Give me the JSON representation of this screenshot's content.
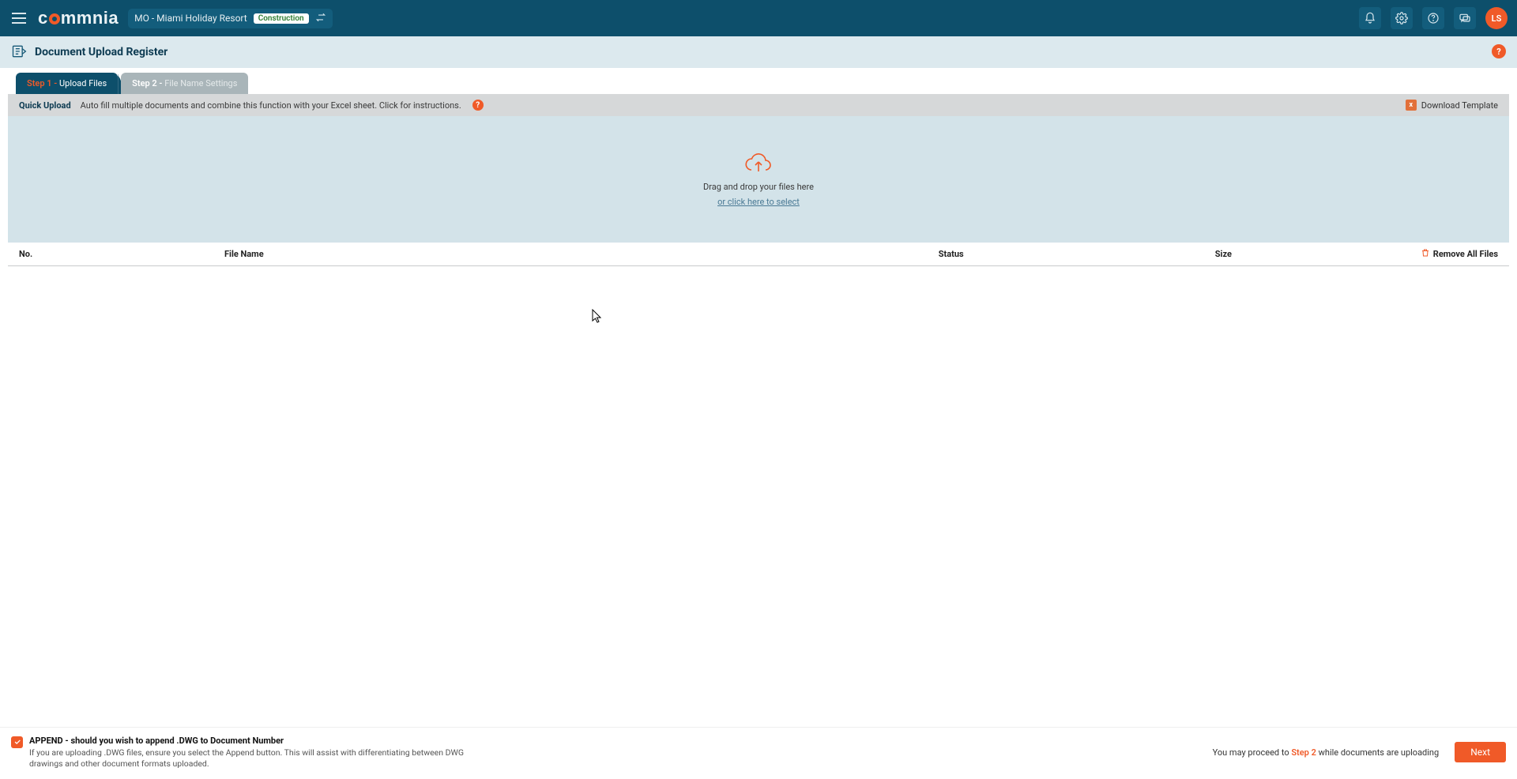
{
  "nav": {
    "project_code": "MO - Miami Holiday Resort",
    "project_stage": "Construction",
    "avatar_initials": "LS"
  },
  "header": {
    "title": "Document Upload Register"
  },
  "tabs": {
    "step1_label": "Step 1 -",
    "step1_name": " Upload Files",
    "step2_label": "Step 2 -",
    "step2_name": " File Name Settings"
  },
  "quick": {
    "title": "Quick Upload",
    "desc": "Auto fill multiple documents and combine this function with your Excel sheet. Click for instructions.",
    "download": "Download Template"
  },
  "dropzone": {
    "line1": "Drag and drop your files here",
    "line2": "or click here to select"
  },
  "table": {
    "no": "No.",
    "file_name": "File Name",
    "status": "Status",
    "size": "Size",
    "remove_all": "Remove All Files"
  },
  "footer": {
    "append_title": "APPEND - should you wish to append .DWG to Document Number",
    "append_desc": "If you are uploading .DWG files, ensure you select the Append button. This will assist with differentiating between DWG drawings and other document formats uploaded.",
    "proceed_pre": "You may proceed to ",
    "proceed_step": "Step 2",
    "proceed_post": " while documents are uploading",
    "next": "Next"
  }
}
